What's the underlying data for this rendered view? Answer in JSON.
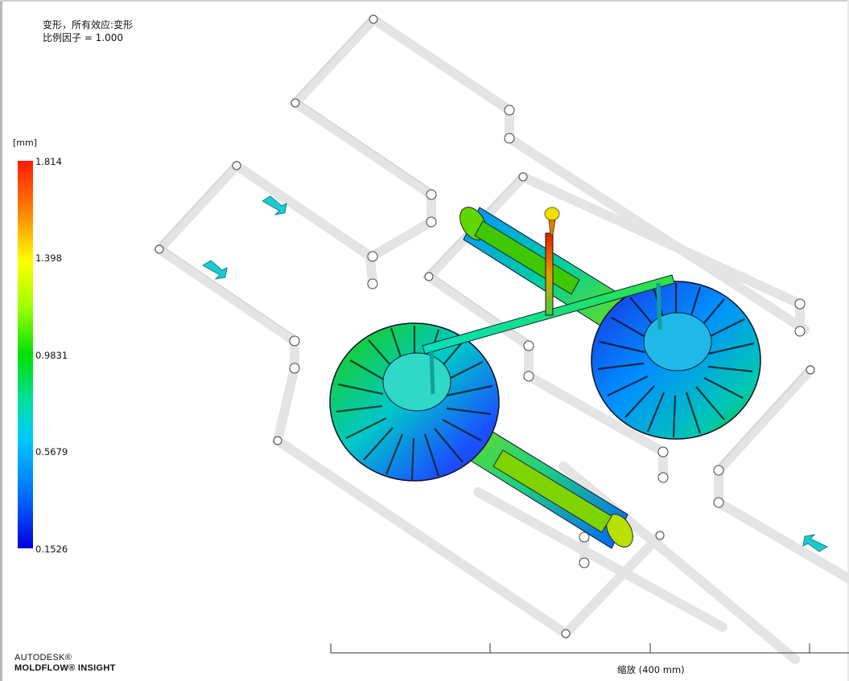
{
  "result": {
    "title": "变形，所有效应:变形",
    "scale_factor": "比例因子 = 1.000"
  },
  "legend": {
    "unit": "[mm]",
    "ticks": [
      "1.814",
      "1.398",
      "0.9831",
      "0.5679",
      "0.1526"
    ]
  },
  "scale_bar": {
    "label": "缩放 (400 mm)"
  },
  "brand": {
    "line1": "AUTODESK®",
    "line2": "MOLDFLOW® INSIGHT"
  },
  "colors": {
    "legend_max": "#ff1a00",
    "legend_mid": "#00e000",
    "legend_min": "#0000e0",
    "channel": "#e6e6e6"
  }
}
